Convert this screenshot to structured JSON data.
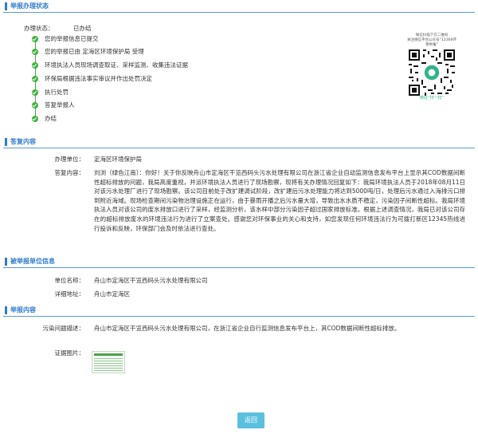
{
  "sections": {
    "report_status": "举报办理状态",
    "reply_content": "答复内容",
    "reported_unit": "被举报单位信息",
    "report_content": "举报内容"
  },
  "status": {
    "label": "办理状态：",
    "value": "已办结",
    "steps": [
      "您的举报信息已提交",
      "您的举报已由 定海区环境保护局 受理",
      "环境执法人员现场调查取证、采样监测、收集违法证据",
      "环保局根据违法事实审议并作出处罚决定",
      "执行处罚",
      "答复举报人",
      "办结"
    ]
  },
  "qr": {
    "caption_line1": "微信扫描下方二维码",
    "caption_line2": "关注微信平台公众号“12369环保举报”",
    "caption_bottom": "微信“扫一扫”"
  },
  "reply": {
    "unit_label": "办理单位：",
    "unit_value": "定海区环境保护局",
    "content_label": "答复内容：",
    "content_value": "刘浏（绿色江南）：你好！关于你反映舟山市定海区干览西码头污水处理有限公司在浙江省企业自动监测信息发布平台上显示其COD数据间断性超标排放的问题，我局高度重视，并派环境执法人员进行了现场勘察，现将有关办理情况回复如下：我局环境执法人员于2018年08月11日对该污水处理厂进行了现场勘察。该公司目前处于改扩建调试阶段，改扩建后污水处理能力将达到5000吨/日，处理后污水通过入海排污口排到附近海域。现场检查期间污染物治理设施正在运行，由于暴雨开播之后污水量大增，导致出水水质不稳定，污染因子间断性超标。我局环境执法人员对该公司的废水排放口进行了采样，经监测分析，该水样中部分污染因子超过国家排放标准。根据上述调查情况，我局已对该公司存在的超标排放废水的环境违法行为进行了立案查处。感谢您对环保事业的关心和支持，如您发现任何环境违法行为可拨打新区12345热线进行投诉和反映，环保部门会及时依法进行查处。"
  },
  "reported": {
    "name_label": "单位名称：",
    "name_value": "舟山市定海区干览西码头污水处理有限公司",
    "addr_label": "详细地址：",
    "addr_value": "舟山市定海区"
  },
  "report": {
    "desc_label": "污染问题描述：",
    "desc_value": "舟山市定海区干览西码头污水处理有限公司，在浙江省企业自行监测信息发布平台上，其COD数据间断性超标排放。",
    "photo_label": "证据图片："
  },
  "back_button": "返回",
  "colors": {
    "accent": "#2e7bcf",
    "step": "#3db33d",
    "button": "#5bc0de"
  }
}
